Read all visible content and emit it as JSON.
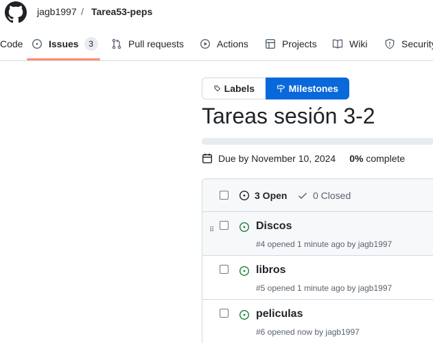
{
  "header": {
    "owner": "jagb1997",
    "separator": "/",
    "repo": "Tarea53-peps"
  },
  "nav": {
    "code": "Code",
    "issues": "Issues",
    "issues_count": "3",
    "pulls": "Pull requests",
    "actions": "Actions",
    "projects": "Projects",
    "wiki": "Wiki",
    "security": "Security"
  },
  "toggle": {
    "labels": "Labels",
    "milestones": "Milestones"
  },
  "milestone": {
    "title": "Tareas sesión 3-2",
    "due": "Due by November 10, 2024",
    "percent": "0%",
    "complete_label": "complete",
    "progress_fraction": 0
  },
  "issues_header": {
    "open": "3 Open",
    "closed": "0 Closed"
  },
  "issues": [
    {
      "title": "Discos",
      "meta": "#4 opened 1 minute ago by jagb1997"
    },
    {
      "title": "libros",
      "meta": "#5 opened 1 minute ago by jagb1997"
    },
    {
      "title": "peliculas",
      "meta": "#6 opened now by jagb1997"
    }
  ],
  "colors": {
    "accent": "#0969da",
    "open_green": "#1a7f37",
    "nav_underline": "#fd8c73"
  },
  "icons": [
    "github-logo-icon",
    "code-icon",
    "issue-opened-icon",
    "git-pull-request-icon",
    "play-icon",
    "table-icon",
    "book-icon",
    "shield-icon",
    "tag-icon",
    "milestone-icon",
    "calendar-icon",
    "check-icon",
    "drag-handle-icon"
  ]
}
